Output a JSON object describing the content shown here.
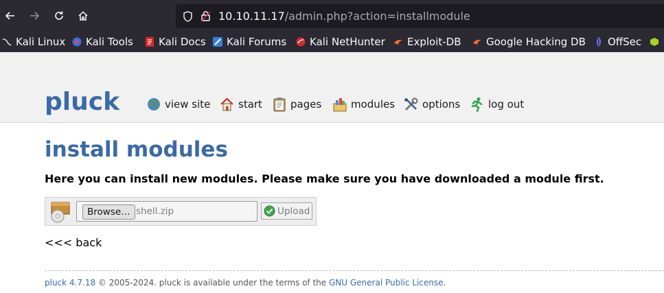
{
  "browser": {
    "url_host": "10.10.11.17",
    "url_path": "/admin.php?action=installmodule",
    "bookmarks": [
      {
        "label": "Kali Linux",
        "icon": "kali-dragon-icon"
      },
      {
        "label": "Kali Tools",
        "icon": "kali-tools-icon"
      },
      {
        "label": "Kali Docs",
        "icon": "kali-docs-icon"
      },
      {
        "label": "Kali Forums",
        "icon": "kali-forums-icon"
      },
      {
        "label": "Kali NetHunter",
        "icon": "kali-nethunter-icon"
      },
      {
        "label": "Exploit-DB",
        "icon": "exploit-db-icon"
      },
      {
        "label": "Google Hacking DB",
        "icon": "ghdb-icon"
      },
      {
        "label": "OffSec",
        "icon": "offsec-icon"
      }
    ]
  },
  "site": {
    "logo": "pluck",
    "menu": [
      {
        "label": "view site",
        "icon": "globe-icon"
      },
      {
        "label": "start",
        "icon": "home-icon"
      },
      {
        "label": "pages",
        "icon": "clipboard-icon"
      },
      {
        "label": "modules",
        "icon": "modules-icon"
      },
      {
        "label": "options",
        "icon": "tools-icon"
      },
      {
        "label": "log out",
        "icon": "running-man-icon"
      }
    ]
  },
  "main": {
    "title": "install modules",
    "intro": "Here you can install new modules. Please make sure you have downloaded a module first.",
    "browse_label": "Browse…",
    "file_name": "shell.zip",
    "upload_label": "Upload",
    "back_label": "<<< back"
  },
  "footer": {
    "product": "pluck 4.7.18",
    "text": " © 2005-2024. pluck is available under the terms of the ",
    "license": "GNU General Public License",
    "end": "."
  },
  "colors": {
    "brand": "#3a6aa7",
    "chrome": "#2b2a33",
    "urlbar": "#1c1b22"
  }
}
